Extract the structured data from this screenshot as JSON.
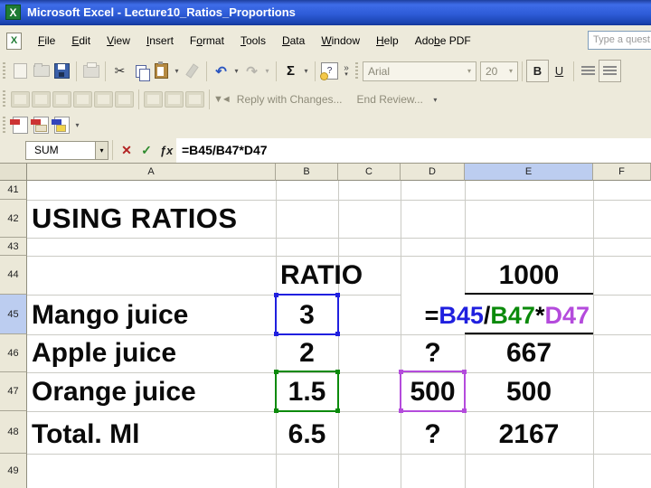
{
  "window": {
    "title": "Microsoft Excel - Lecture10_Ratios_Proportions"
  },
  "menubar": {
    "items": [
      {
        "pre": "",
        "accel": "F",
        "post": "ile"
      },
      {
        "pre": "",
        "accel": "E",
        "post": "dit"
      },
      {
        "pre": "",
        "accel": "V",
        "post": "iew"
      },
      {
        "pre": "",
        "accel": "I",
        "post": "nsert"
      },
      {
        "pre": "F",
        "accel": "o",
        "post": "rmat"
      },
      {
        "pre": "",
        "accel": "T",
        "post": "ools"
      },
      {
        "pre": "",
        "accel": "D",
        "post": "ata"
      },
      {
        "pre": "",
        "accel": "W",
        "post": "indow"
      },
      {
        "pre": "",
        "accel": "H",
        "post": "elp"
      },
      {
        "pre": "Ado",
        "accel": "b",
        "post": "e PDF"
      }
    ],
    "question_box": "Type a quest"
  },
  "icons": {
    "dropdown": "▾",
    "overflow": "»",
    "cut": "✂",
    "undo": "↶",
    "redo": "↷",
    "sum": "Σ",
    "cancel": "✕",
    "enter": "✓",
    "insert_function": "ƒx",
    "help": "?",
    "flags": "▼◄"
  },
  "formatting_toolbar": {
    "font": "Arial",
    "size": "20",
    "bold": "B",
    "underline": "U"
  },
  "reviewing_toolbar": {
    "reply": "Reply with Changes...",
    "end_review": "End Review..."
  },
  "formula_bar": {
    "name_box": "SUM",
    "formula": "=B45/B47*D47"
  },
  "sheet": {
    "columns": [
      "A",
      "B",
      "C",
      "D",
      "E",
      "F"
    ],
    "rows": [
      "41",
      "42",
      "43",
      "44",
      "45",
      "46",
      "47",
      "48",
      "49"
    ],
    "selected_column": "E",
    "selected_row": "45",
    "cells": {
      "a42": "USING RATIOS",
      "b44": "RATIO",
      "e44": "1000",
      "a45": "Mango juice",
      "b45": "3",
      "a46": "Apple juice",
      "b46": "2",
      "d46": "?",
      "e46": "667",
      "a47": "Orange juice",
      "b47": "1.5",
      "d47": "500",
      "e47": "500",
      "a48": "Total. Ml",
      "b48": "6.5",
      "d48": "?",
      "e48": "2167"
    },
    "formula": {
      "eq": "=",
      "ref1": "B45",
      "op1": "/",
      "ref2": "B47",
      "op2": "*",
      "ref3": "D47"
    },
    "colors": {
      "ref1": "#2020DF",
      "ref2": "#0B8A0B",
      "ref3": "#B44BDC",
      "selection": "#BCCDF0"
    }
  }
}
